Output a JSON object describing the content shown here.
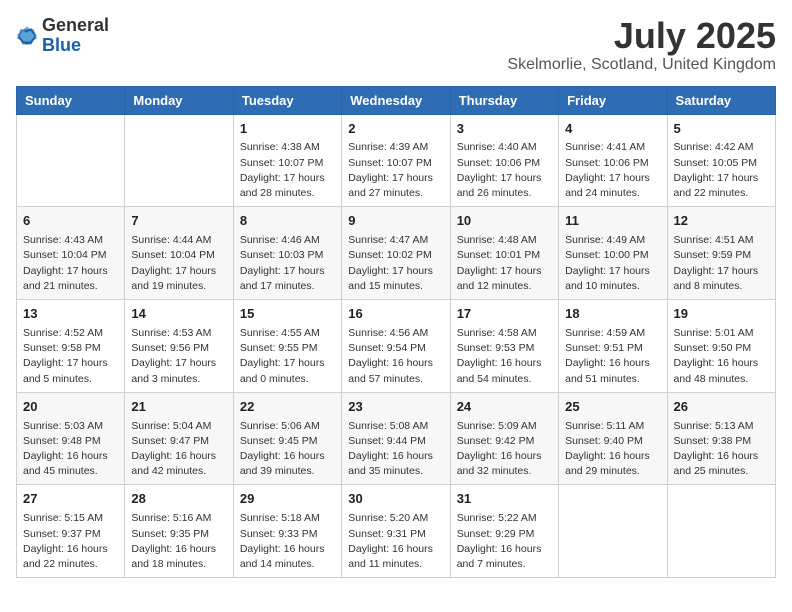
{
  "header": {
    "logo_general": "General",
    "logo_blue": "Blue",
    "title": "July 2025",
    "location": "Skelmorlie, Scotland, United Kingdom"
  },
  "days_of_week": [
    "Sunday",
    "Monday",
    "Tuesday",
    "Wednesday",
    "Thursday",
    "Friday",
    "Saturday"
  ],
  "weeks": [
    [
      {
        "day": "",
        "info": ""
      },
      {
        "day": "",
        "info": ""
      },
      {
        "day": "1",
        "info": "Sunrise: 4:38 AM\nSunset: 10:07 PM\nDaylight: 17 hours and 28 minutes."
      },
      {
        "day": "2",
        "info": "Sunrise: 4:39 AM\nSunset: 10:07 PM\nDaylight: 17 hours and 27 minutes."
      },
      {
        "day": "3",
        "info": "Sunrise: 4:40 AM\nSunset: 10:06 PM\nDaylight: 17 hours and 26 minutes."
      },
      {
        "day": "4",
        "info": "Sunrise: 4:41 AM\nSunset: 10:06 PM\nDaylight: 17 hours and 24 minutes."
      },
      {
        "day": "5",
        "info": "Sunrise: 4:42 AM\nSunset: 10:05 PM\nDaylight: 17 hours and 22 minutes."
      }
    ],
    [
      {
        "day": "6",
        "info": "Sunrise: 4:43 AM\nSunset: 10:04 PM\nDaylight: 17 hours and 21 minutes."
      },
      {
        "day": "7",
        "info": "Sunrise: 4:44 AM\nSunset: 10:04 PM\nDaylight: 17 hours and 19 minutes."
      },
      {
        "day": "8",
        "info": "Sunrise: 4:46 AM\nSunset: 10:03 PM\nDaylight: 17 hours and 17 minutes."
      },
      {
        "day": "9",
        "info": "Sunrise: 4:47 AM\nSunset: 10:02 PM\nDaylight: 17 hours and 15 minutes."
      },
      {
        "day": "10",
        "info": "Sunrise: 4:48 AM\nSunset: 10:01 PM\nDaylight: 17 hours and 12 minutes."
      },
      {
        "day": "11",
        "info": "Sunrise: 4:49 AM\nSunset: 10:00 PM\nDaylight: 17 hours and 10 minutes."
      },
      {
        "day": "12",
        "info": "Sunrise: 4:51 AM\nSunset: 9:59 PM\nDaylight: 17 hours and 8 minutes."
      }
    ],
    [
      {
        "day": "13",
        "info": "Sunrise: 4:52 AM\nSunset: 9:58 PM\nDaylight: 17 hours and 5 minutes."
      },
      {
        "day": "14",
        "info": "Sunrise: 4:53 AM\nSunset: 9:56 PM\nDaylight: 17 hours and 3 minutes."
      },
      {
        "day": "15",
        "info": "Sunrise: 4:55 AM\nSunset: 9:55 PM\nDaylight: 17 hours and 0 minutes."
      },
      {
        "day": "16",
        "info": "Sunrise: 4:56 AM\nSunset: 9:54 PM\nDaylight: 16 hours and 57 minutes."
      },
      {
        "day": "17",
        "info": "Sunrise: 4:58 AM\nSunset: 9:53 PM\nDaylight: 16 hours and 54 minutes."
      },
      {
        "day": "18",
        "info": "Sunrise: 4:59 AM\nSunset: 9:51 PM\nDaylight: 16 hours and 51 minutes."
      },
      {
        "day": "19",
        "info": "Sunrise: 5:01 AM\nSunset: 9:50 PM\nDaylight: 16 hours and 48 minutes."
      }
    ],
    [
      {
        "day": "20",
        "info": "Sunrise: 5:03 AM\nSunset: 9:48 PM\nDaylight: 16 hours and 45 minutes."
      },
      {
        "day": "21",
        "info": "Sunrise: 5:04 AM\nSunset: 9:47 PM\nDaylight: 16 hours and 42 minutes."
      },
      {
        "day": "22",
        "info": "Sunrise: 5:06 AM\nSunset: 9:45 PM\nDaylight: 16 hours and 39 minutes."
      },
      {
        "day": "23",
        "info": "Sunrise: 5:08 AM\nSunset: 9:44 PM\nDaylight: 16 hours and 35 minutes."
      },
      {
        "day": "24",
        "info": "Sunrise: 5:09 AM\nSunset: 9:42 PM\nDaylight: 16 hours and 32 minutes."
      },
      {
        "day": "25",
        "info": "Sunrise: 5:11 AM\nSunset: 9:40 PM\nDaylight: 16 hours and 29 minutes."
      },
      {
        "day": "26",
        "info": "Sunrise: 5:13 AM\nSunset: 9:38 PM\nDaylight: 16 hours and 25 minutes."
      }
    ],
    [
      {
        "day": "27",
        "info": "Sunrise: 5:15 AM\nSunset: 9:37 PM\nDaylight: 16 hours and 22 minutes."
      },
      {
        "day": "28",
        "info": "Sunrise: 5:16 AM\nSunset: 9:35 PM\nDaylight: 16 hours and 18 minutes."
      },
      {
        "day": "29",
        "info": "Sunrise: 5:18 AM\nSunset: 9:33 PM\nDaylight: 16 hours and 14 minutes."
      },
      {
        "day": "30",
        "info": "Sunrise: 5:20 AM\nSunset: 9:31 PM\nDaylight: 16 hours and 11 minutes."
      },
      {
        "day": "31",
        "info": "Sunrise: 5:22 AM\nSunset: 9:29 PM\nDaylight: 16 hours and 7 minutes."
      },
      {
        "day": "",
        "info": ""
      },
      {
        "day": "",
        "info": ""
      }
    ]
  ]
}
